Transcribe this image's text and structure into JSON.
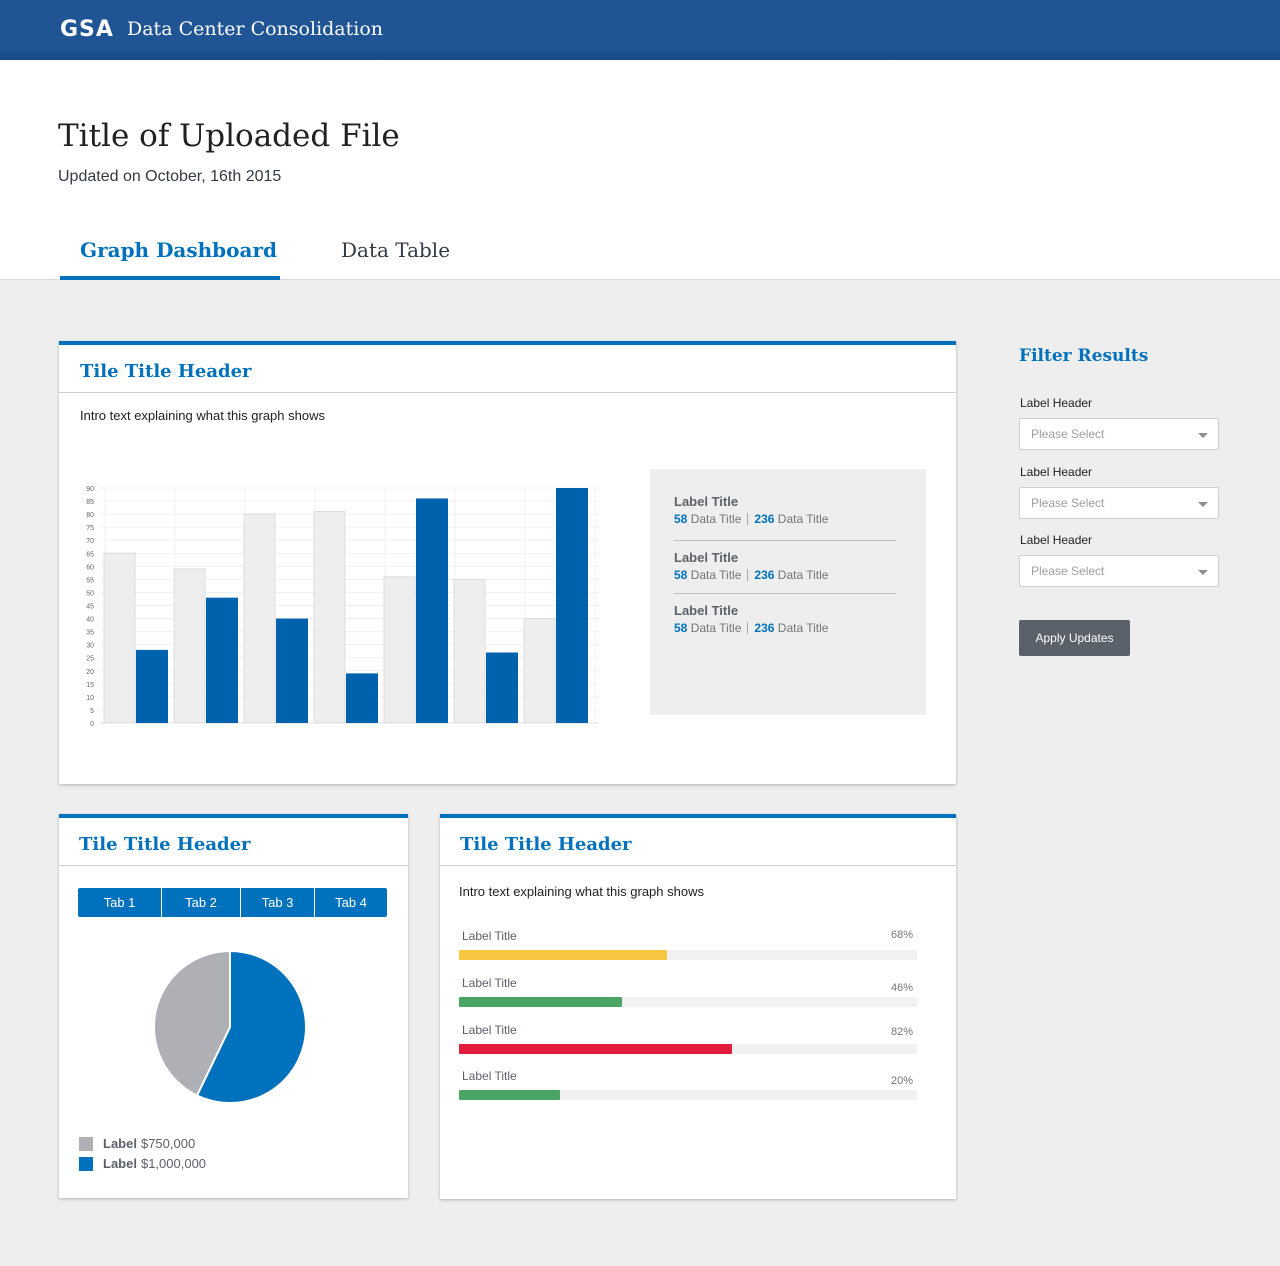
{
  "topbar": {
    "logo": "GSA",
    "app_title": "Data Center Consolidation"
  },
  "header": {
    "title": "Title of Uploaded File",
    "updated": "Updated on October, 16th 2015",
    "tabs": [
      {
        "label": "Graph Dashboard",
        "active": true
      },
      {
        "label": "Data Table",
        "active": false
      }
    ]
  },
  "tile_bar": {
    "title": "Tile Title Header",
    "intro": "Intro text explaining what this graph shows",
    "stats": [
      {
        "label": "Label Title",
        "num1": "58",
        "text1": "Data Title",
        "num2": "236",
        "text2": "Data Title"
      },
      {
        "label": "Label Title",
        "num1": "58",
        "text1": "Data Title",
        "num2": "236",
        "text2": "Data Title"
      },
      {
        "label": "Label Title",
        "num1": "58",
        "text1": "Data Title",
        "num2": "236",
        "text2": "Data Title"
      }
    ]
  },
  "tile_pie": {
    "title": "Tile Title Header",
    "tabs": [
      "Tab 1",
      "Tab 2",
      "Tab 3",
      "Tab 4"
    ],
    "legend": [
      {
        "label": "Label",
        "value": "$750,000",
        "color": "#aeb0b5"
      },
      {
        "label": "Label",
        "value": "$1,000,000",
        "color": "#0071bc"
      }
    ]
  },
  "tile_progress": {
    "title": "Tile Title Header",
    "intro": "Intro text explaining what this graph shows",
    "bars": [
      {
        "label": "Label Title",
        "pct_text": "68%",
        "fill": 0.455,
        "color": "#f9c642"
      },
      {
        "label": "Label Title",
        "pct_text": "46%",
        "fill": 0.355,
        "color": "#4aa564"
      },
      {
        "label": "Label Title",
        "pct_text": "82%",
        "fill": 0.595,
        "color": "#e31c3d"
      },
      {
        "label": "Label Title",
        "pct_text": "20%",
        "fill": 0.22,
        "color": "#4aa564"
      }
    ]
  },
  "sidebar": {
    "title": "Filter Results",
    "filters": [
      {
        "label": "Label Header",
        "placeholder": "Please Select"
      },
      {
        "label": "Label Header",
        "placeholder": "Please Select"
      },
      {
        "label": "Label Header",
        "placeholder": "Please Select"
      }
    ],
    "apply_label": "Apply Updates"
  },
  "chart_data": [
    {
      "type": "bar",
      "ylim": [
        0,
        90
      ],
      "yticks": [
        "0",
        "5",
        "10",
        "15",
        "20",
        "25",
        "30",
        "35",
        "40",
        "45",
        "50",
        "55",
        "60",
        "65",
        "70",
        "75",
        "80",
        "85",
        "90"
      ],
      "grid": true,
      "series": [
        {
          "values": [
            65,
            59,
            80,
            81,
            56,
            55,
            40
          ],
          "color": "#eeeeee"
        },
        {
          "values": [
            28,
            48,
            40,
            19,
            86,
            27,
            90
          ],
          "color": "#0061ad"
        }
      ]
    },
    {
      "type": "pie",
      "values": [
        750000,
        1000000
      ],
      "labels": [
        "Label",
        "Label"
      ],
      "colors": [
        "#aeb0b5",
        "#0071bc"
      ]
    }
  ]
}
